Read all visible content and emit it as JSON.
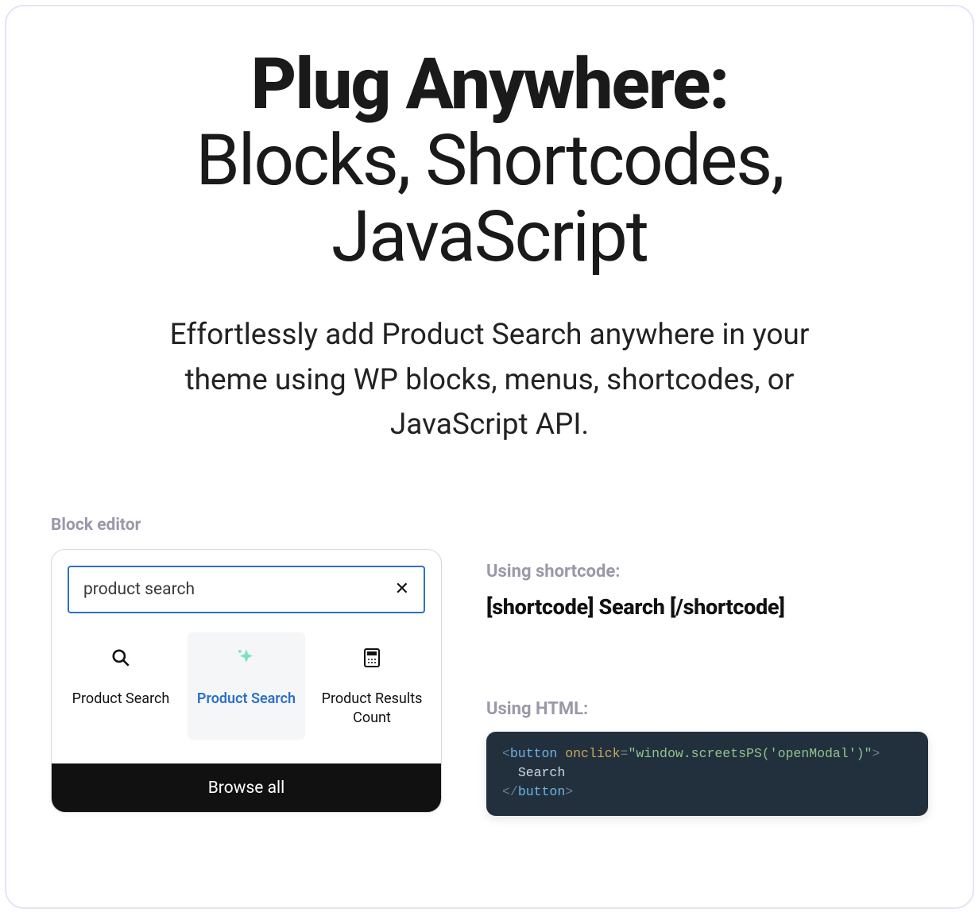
{
  "hero": {
    "title_bold": "Plug Anywhere:",
    "title_rest": "Blocks, Shortcodes, JavaScript",
    "subtitle": "Effortlessly add Product Search anywhere in your theme using WP blocks, menus, shortcodes, or JavaScript API."
  },
  "block_editor": {
    "label": "Block editor",
    "search_value": "product search",
    "tiles": [
      {
        "name": "Product Search"
      },
      {
        "name": "Product Search"
      },
      {
        "name": "Product Results Count"
      }
    ],
    "browse_all": "Browse all"
  },
  "right": {
    "shortcode_label": "Using shortcode:",
    "shortcode_text": "[shortcode] Search [/shortcode]",
    "html_label": "Using HTML:",
    "code": {
      "tag": "button",
      "attr": "onclick",
      "val": "\"window.screetsPS('openModal')\"",
      "inner": "Search"
    }
  }
}
